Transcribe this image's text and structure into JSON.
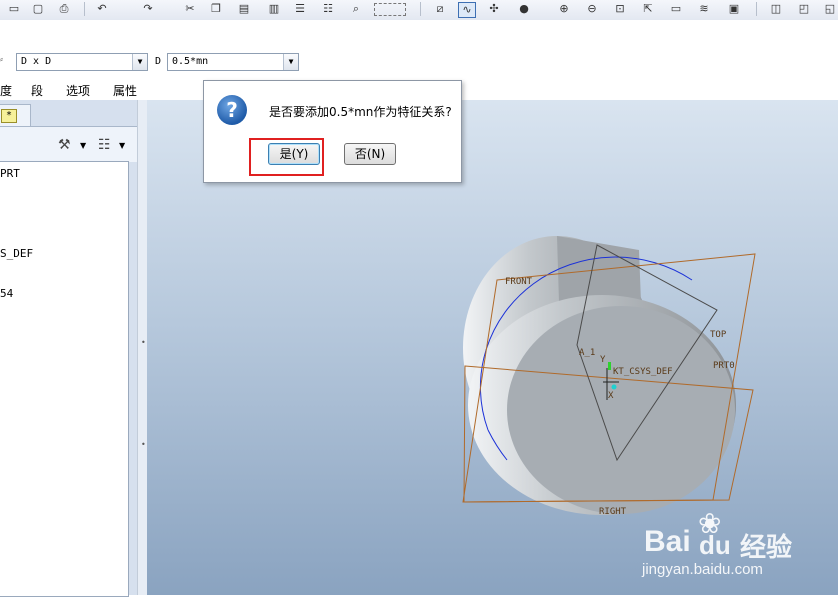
{
  "toolbar": {
    "icons": [
      "new-icon",
      "open-icon",
      "save-icon",
      "print-icon",
      "undo-icon",
      "redo-icon",
      "cut-icon",
      "copy-icon",
      "paste-icon",
      "paste-special-icon",
      "regen-icon",
      "regen-manager-icon",
      "find-icon",
      "select-box-icon",
      "datum-icon",
      "sketch-icon",
      "spin-center-icon",
      "shading-icon",
      "zoom-in-icon",
      "zoom-out-icon",
      "refit-icon",
      "reorient-icon",
      "saved-views-icon",
      "layers-icon",
      "view-manager-icon",
      "display-style-icon"
    ]
  },
  "dashboard": {
    "type_combo": {
      "value": "D x D"
    },
    "d_label": "D",
    "d_combo": {
      "value": "0.5*mn"
    },
    "menu": [
      "度",
      "段",
      "选项",
      "属性"
    ]
  },
  "panel": {
    "badge": "*",
    "tree_items": [
      "PRT",
      "S_DEF",
      "54"
    ]
  },
  "viewport": {
    "datum_labels": [
      "FRONT",
      "TOP",
      "PRT0",
      "A_1",
      "KT_CSYS_DEF",
      "RIGHT",
      "Y",
      "X"
    ]
  },
  "dialog": {
    "message": "是否要添加0.5*mn作为特征关系?",
    "yes_label": "是(Y)",
    "no_label": "否(N)"
  },
  "watermark": {
    "brand": "Bai",
    "brand2": "du",
    "cn": "经验",
    "url": "jingyan.baidu.com"
  }
}
